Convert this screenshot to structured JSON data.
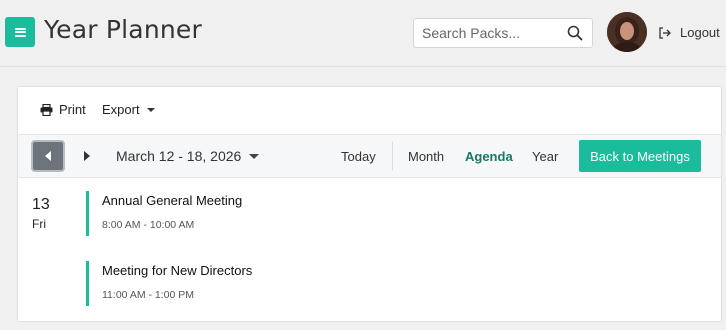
{
  "header": {
    "title": "Year Planner",
    "search_placeholder": "Search Packs...",
    "logout_label": "Logout",
    "accent_color": "#1abc9c"
  },
  "actions": {
    "print_label": "Print",
    "export_label": "Export"
  },
  "toolbar": {
    "date_range": "March 12 - 18, 2026",
    "today_label": "Today",
    "views": {
      "month": "Month",
      "agenda": "Agenda",
      "year": "Year"
    },
    "active_view": "Agenda",
    "back_label": "Back to Meetings"
  },
  "agenda": {
    "day": {
      "number": "13",
      "weekday": "Fri"
    },
    "events": [
      {
        "title": "Annual General Meeting",
        "time": "8:00 AM - 10:00 AM"
      },
      {
        "title": "Meeting for New Directors",
        "time": "11:00 AM - 1:00 PM"
      }
    ]
  }
}
